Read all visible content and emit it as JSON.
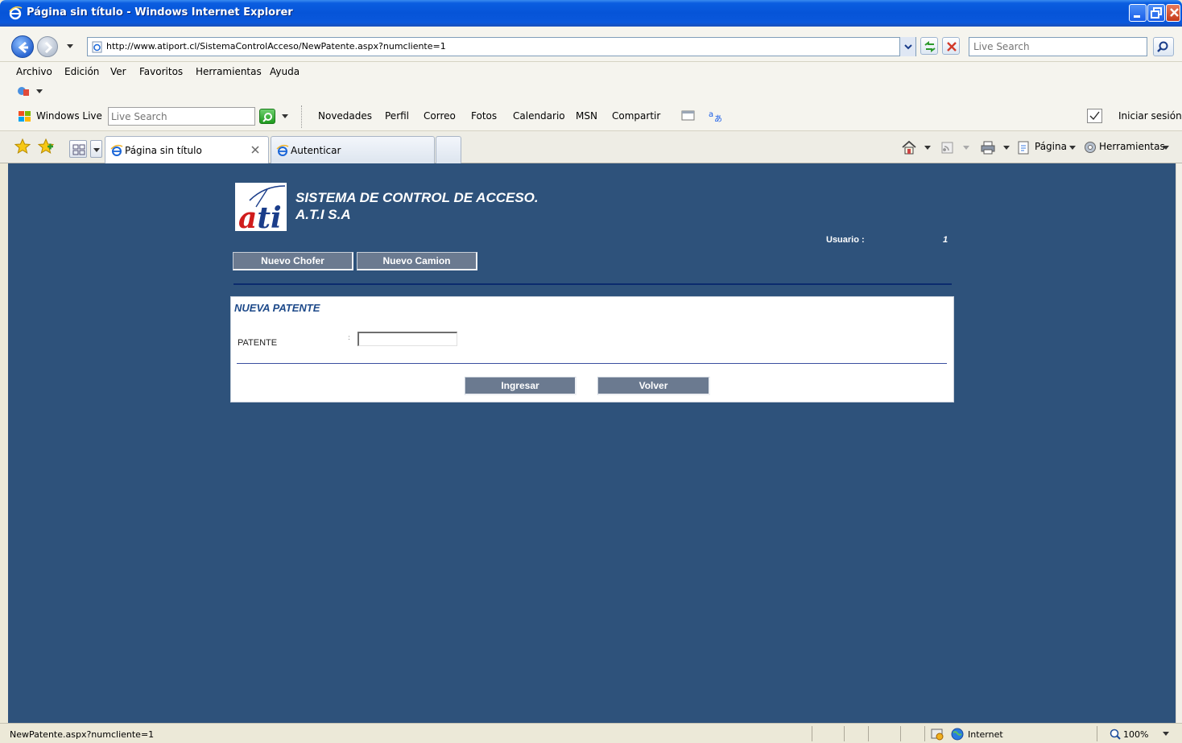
{
  "window": {
    "title": "Página sin título - Windows Internet Explorer"
  },
  "address": {
    "url": "http://www.atiport.cl/SistemaControlAcceso/NewPatente.aspx?numcliente=1",
    "search_placeholder": "Live Search"
  },
  "menu": {
    "items": [
      "Archivo",
      "Edición",
      "Ver",
      "Favoritos",
      "Herramientas",
      "Ayuda"
    ]
  },
  "live_toolbar": {
    "brand": "Windows Live",
    "search_placeholder": "Live Search",
    "links": [
      "Novedades",
      "Perfil",
      "Correo",
      "Fotos",
      "Calendario",
      "MSN",
      "Compartir"
    ],
    "signin": "Iniciar sesión"
  },
  "tabs": [
    {
      "label": "Página sin título",
      "active": true
    },
    {
      "label": "Autenticar",
      "active": false
    }
  ],
  "command_bar": {
    "page_label": "Página",
    "tools_label": "Herramientas"
  },
  "page": {
    "logo_text_a": "a",
    "logo_text_ti": "ti",
    "system_title": "SISTEMA DE CONTROL DE ACCESO.",
    "company": "A.T.I S.A",
    "user_label": "Usuario :",
    "user_value": "1",
    "nav_buttons": [
      "Nuevo Chofer",
      "Nuevo Camion"
    ],
    "panel_title": "NUEVA PATENTE",
    "field_label": "PATENTE",
    "field_colon": ":",
    "field_value": "",
    "submit_label": "Ingresar",
    "back_label": "Volver"
  },
  "status": {
    "text": "NewPatente.aspx?numcliente=1",
    "zone": "Internet",
    "zoom": "100%"
  },
  "colors": {
    "content_bg": "#2e527b",
    "button_bg": "#6b7a90",
    "panel_title": "#1e4a8a"
  }
}
